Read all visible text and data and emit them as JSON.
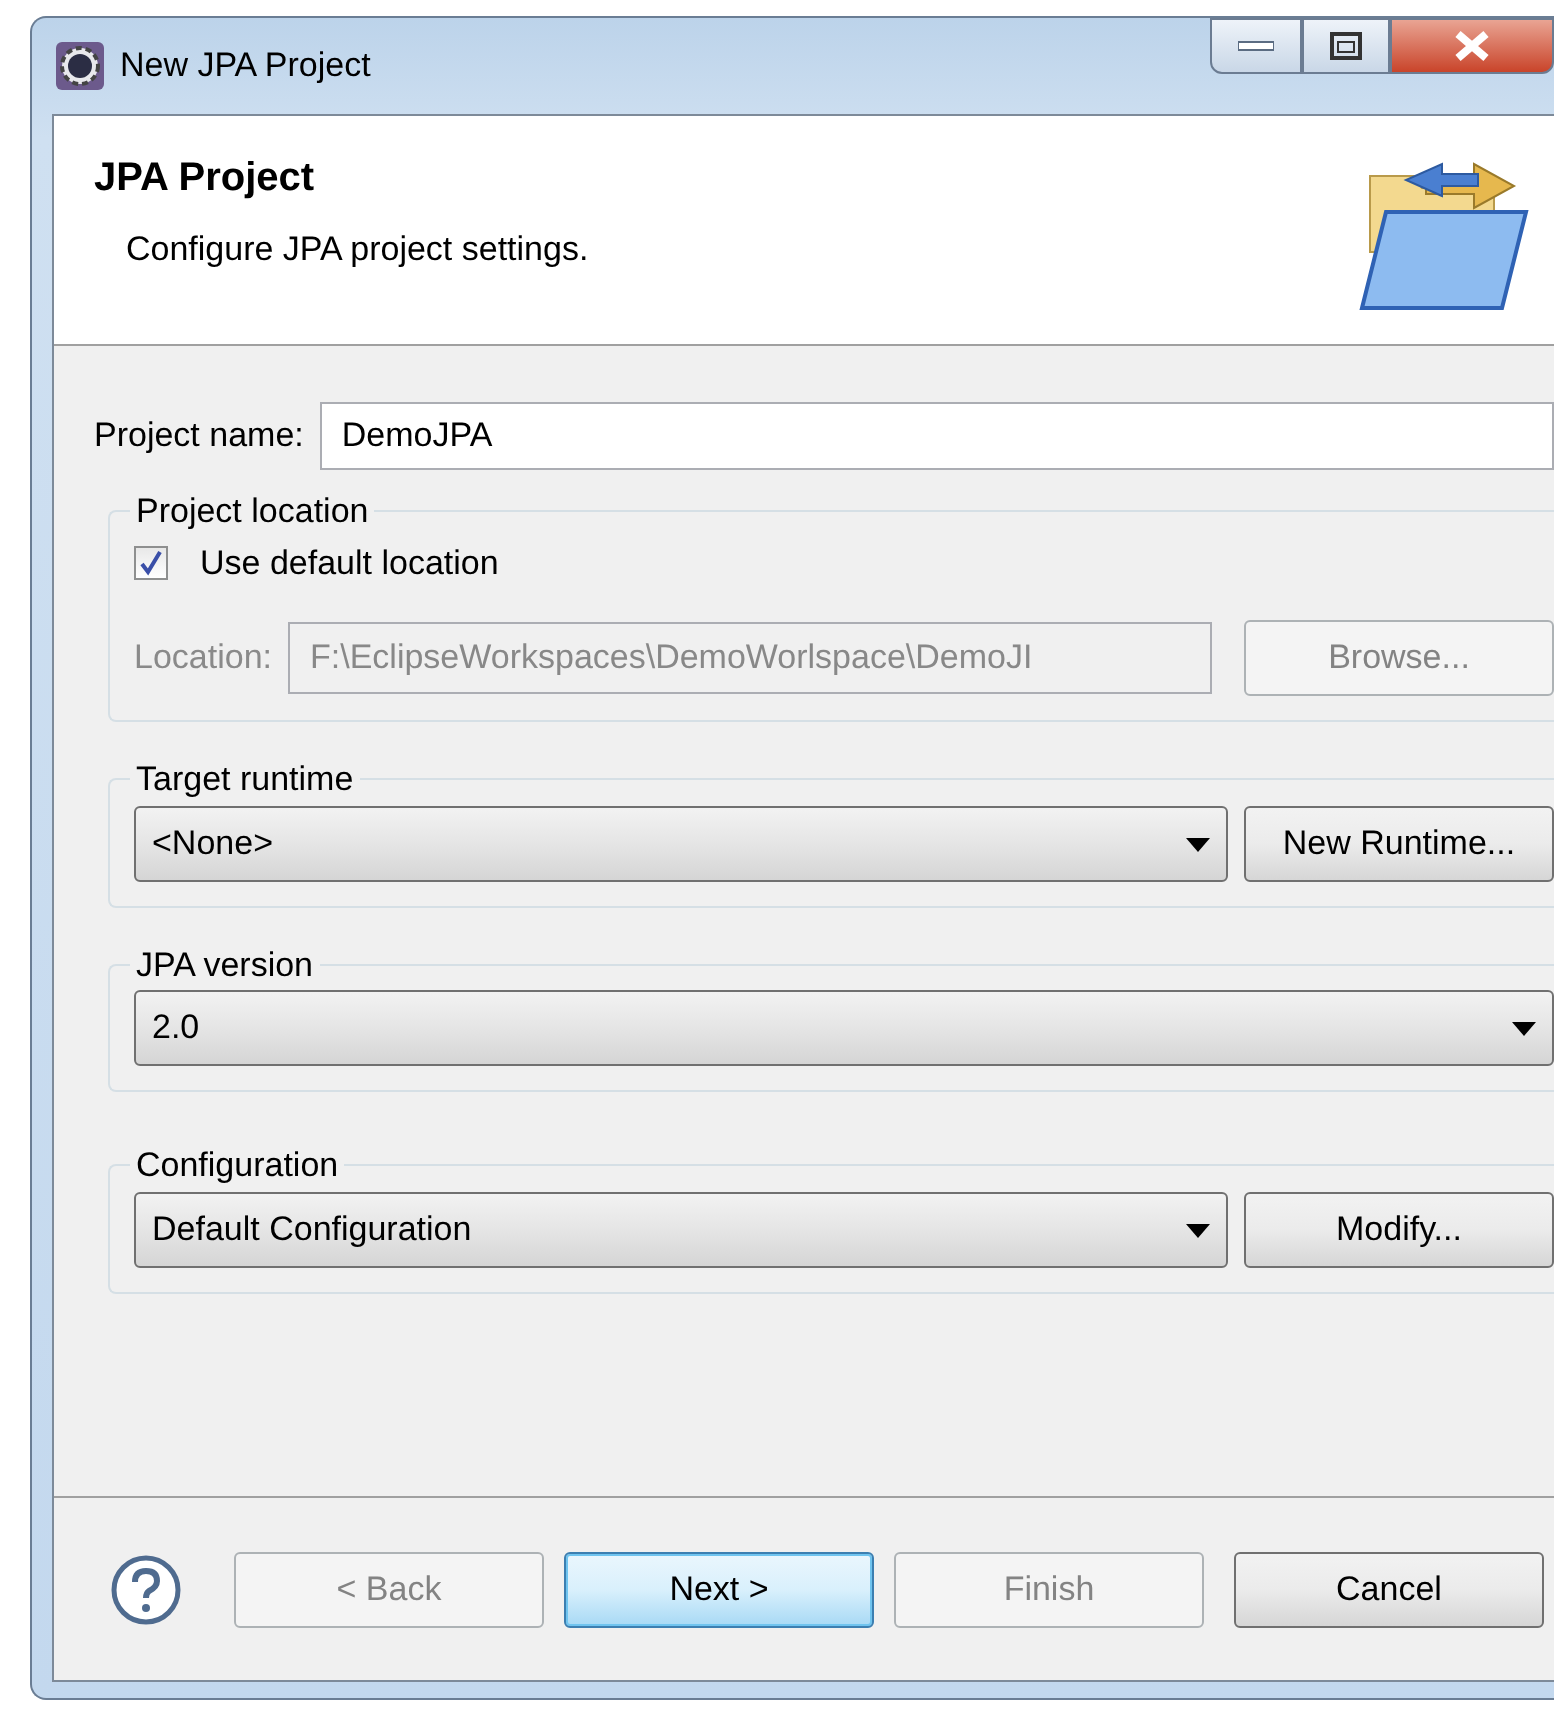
{
  "window": {
    "title": "New JPA Project"
  },
  "header": {
    "title": "JPA Project",
    "description": "Configure JPA project settings."
  },
  "project_name": {
    "label": "Project name:",
    "value": "DemoJPA"
  },
  "project_location": {
    "title": "Project location",
    "use_default": {
      "label": "Use default location",
      "checked": true
    },
    "location": {
      "label": "Location:",
      "value": "F:\\EclipseWorkspaces\\DemoWorlspace\\DemoJI",
      "disabled": true
    },
    "browse": {
      "label": "Browse...",
      "disabled": true
    }
  },
  "target_runtime": {
    "title": "Target runtime",
    "value": "<None>",
    "button": "New Runtime..."
  },
  "jpa_version": {
    "title": "JPA version",
    "value": "2.0"
  },
  "configuration": {
    "title": "Configuration",
    "value": "Default Configuration",
    "button": "Modify..."
  },
  "buttons": [
    {
      "label": "< Back",
      "disabled": true,
      "default": false
    },
    {
      "label": "Next >",
      "disabled": false,
      "default": true
    },
    {
      "label": "Finish",
      "disabled": true,
      "default": false
    },
    {
      "label": "Cancel",
      "disabled": false,
      "default": false
    }
  ]
}
